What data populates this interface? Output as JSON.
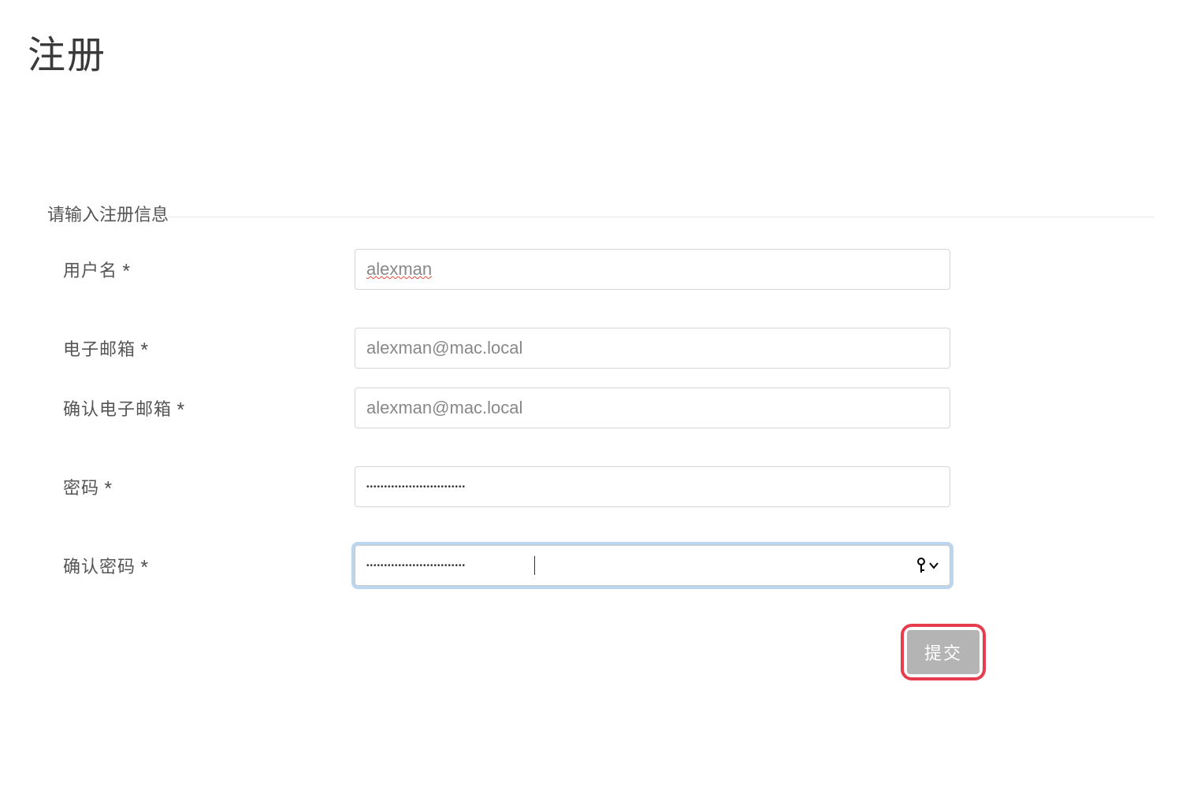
{
  "page": {
    "title": "注册"
  },
  "form": {
    "legend": "请输入注册信息",
    "fields": {
      "username": {
        "label": "用户名 *",
        "value": "alexman"
      },
      "email": {
        "label": "电子邮箱 *",
        "value": "alexman@mac.local"
      },
      "confirm_email": {
        "label": "确认电子邮箱 *",
        "value": "alexman@mac.local"
      },
      "password": {
        "label": "密码 *",
        "value": "••••••••••••••••••••••••••••"
      },
      "confirm_password": {
        "label": "确认密码 *",
        "value": "••••••••••••••••••••••••••••"
      }
    },
    "submit_label": "提交"
  }
}
